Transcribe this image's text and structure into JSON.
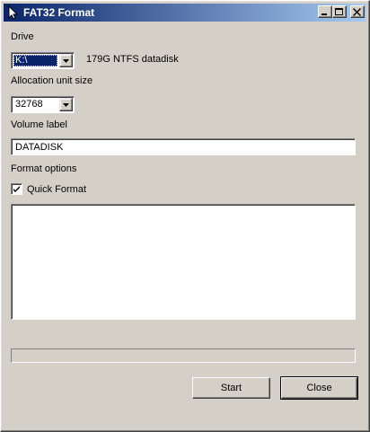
{
  "window": {
    "title": "FAT32 Format",
    "icon": "app-icon",
    "controls": [
      "minimize-icon",
      "maximize-icon",
      "close-icon"
    ]
  },
  "drive": {
    "label": "Drive",
    "selected": "K:\\",
    "info": "179G NTFS datadisk"
  },
  "allocation": {
    "label": "Allocation unit size",
    "selected": "32768"
  },
  "volume": {
    "label": "Volume label",
    "value": "DATADISK"
  },
  "format_options": {
    "label": "Format options",
    "quick_format_label": "Quick Format",
    "quick_format_checked": true
  },
  "log": {
    "text": ""
  },
  "progress": {
    "fraction": 0
  },
  "buttons": {
    "start": "Start",
    "close": "Close"
  },
  "colors": {
    "face": "#d4d0c8",
    "titlebar_start": "#0a246a",
    "titlebar_end": "#a6caf0",
    "selection": "#0a246a"
  }
}
